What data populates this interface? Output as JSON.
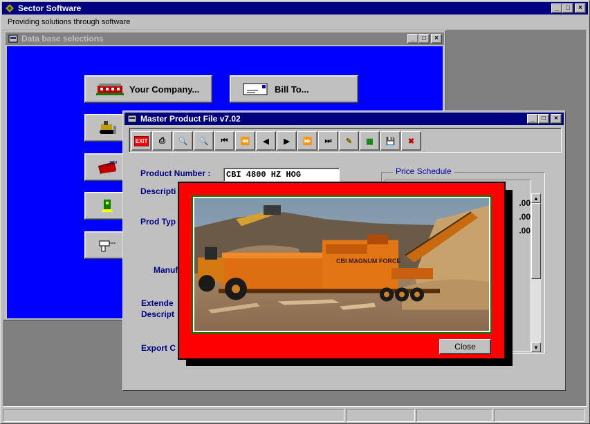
{
  "app": {
    "title": "Sector Software",
    "menu_text": "Providing solutions through software",
    "title_controls": {
      "minimize": "_",
      "maximize": "□",
      "close": "×"
    }
  },
  "db_window": {
    "title": "Data base selections",
    "buttons": [
      {
        "label": "Your Company...",
        "icon": "building-icon"
      },
      {
        "label": "Bill To...",
        "icon": "envelope-icon"
      },
      {
        "label": "",
        "icon": "bulldozer-icon"
      },
      {
        "label": "",
        "icon": "books-icon"
      },
      {
        "label": "",
        "icon": "tag-icon"
      },
      {
        "label": "",
        "icon": "drill-icon"
      }
    ]
  },
  "mpf_window": {
    "title": "Master Product File v7.02",
    "toolbar": [
      {
        "name": "exit",
        "icon": "exit-icon",
        "glyph": "EXIT"
      },
      {
        "name": "print",
        "icon": "printer-icon",
        "glyph": "⎙"
      },
      {
        "name": "find",
        "icon": "magnifier-icon",
        "glyph": "🔍"
      },
      {
        "name": "find-next",
        "icon": "magnifier-next-icon",
        "glyph": "🔍"
      },
      {
        "name": "first",
        "icon": "first-record-icon",
        "glyph": "⏮"
      },
      {
        "name": "prev-page",
        "icon": "rewind-icon",
        "glyph": "⏪"
      },
      {
        "name": "prev",
        "icon": "prev-record-icon",
        "glyph": "◀"
      },
      {
        "name": "next",
        "icon": "next-record-icon",
        "glyph": "▶"
      },
      {
        "name": "next-page",
        "icon": "fast-forward-icon",
        "glyph": "⏩"
      },
      {
        "name": "last",
        "icon": "last-record-icon",
        "glyph": "⏭"
      },
      {
        "name": "edit",
        "icon": "edit-icon",
        "glyph": "✎"
      },
      {
        "name": "grid",
        "icon": "grid-icon",
        "glyph": "▦"
      },
      {
        "name": "save",
        "icon": "save-icon",
        "glyph": "💾"
      },
      {
        "name": "delete",
        "icon": "delete-icon",
        "glyph": "✖"
      }
    ],
    "labels": {
      "product_number": "Product Number :",
      "description": "Descripti",
      "prod_type": "Prod Typ",
      "manuf": "Manuf. N",
      "extended": "Extende",
      "description2": "Descript",
      "export": "Export C"
    },
    "product_number_value": "CBI 4800 HZ HOG",
    "price_schedule": {
      "legend": "Price Schedule",
      "rows": [
        ".00",
        ".00",
        ".00"
      ]
    }
  },
  "popup": {
    "close_label": "Close",
    "photo_label": "CBI MAGNUM FORCE"
  }
}
